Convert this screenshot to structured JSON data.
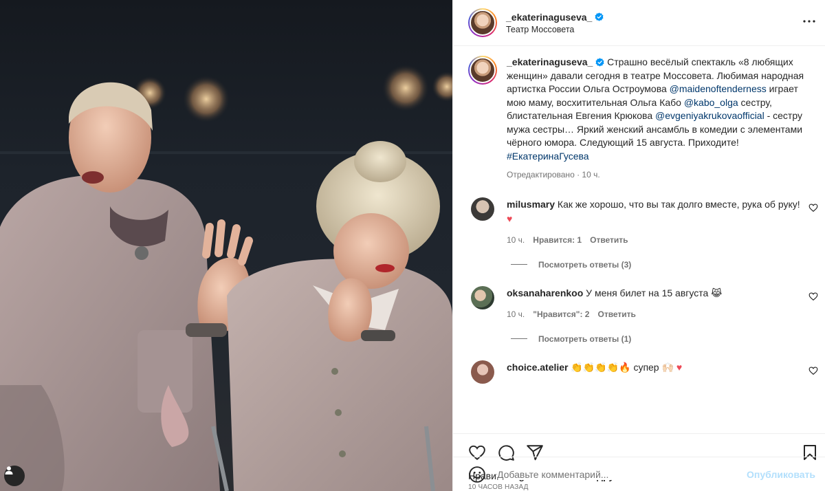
{
  "post": {
    "username": "_ekaterinaguseva_",
    "location": "Театр Моссовета",
    "caption_user": "_ekaterinaguseva_",
    "caption_text_1": " Страшно весёлый спектакль «8 любящих женщин» давали сегодня в театре Моссовета. Любимая народная артистка России Ольга Остроумова ",
    "mention_1": "@maidenoftenderness",
    "caption_text_2": " играет мою маму, восхитительная Ольга Кабо ",
    "mention_2": "@kabo_olga",
    "caption_text_3": " сестру, блистательная Евгения Крюкова ",
    "mention_3": "@evgeniyakrukovaofficial",
    "caption_text_4": " - сестру мужа сестры… Яркий женский ансамбль в комедии с элементами чёрного юмора. Следующий 15 августа. Приходите! ",
    "hashtag": "#ЕкатеринаГусева",
    "caption_meta": "Отредактировано · 10 ч."
  },
  "comments": [
    {
      "user": "milusmary",
      "text": " Как же хорошо, что вы так долго вместе, рука об руку! ",
      "emoji": "♥",
      "time": "10 ч.",
      "likes": "Нравится: 1",
      "reply": "Ответить",
      "replies": "Посмотреть ответы (3)"
    },
    {
      "user": "oksanaharenkoo",
      "text": " У меня билет на 15 августа ",
      "emoji": "😹",
      "time": "10 ч.",
      "likes": "\"Нравится\": 2",
      "reply": "Ответить",
      "replies": "Посмотреть ответы (1)"
    },
    {
      "user": "choice.atelier",
      "text": " 👏👏👏👏🔥 супер 🙌🏻",
      "emoji": "♥"
    }
  ],
  "likes": {
    "prefix": "Нравится ",
    "user": "agurianova5003",
    "middle": " и ",
    "suffix": "другим"
  },
  "date": "10 ЧАСОВ НАЗАД",
  "add_comment": {
    "placeholder": "Добавьте комментарий...",
    "publish": "Опубликовать"
  },
  "colors": {
    "accent": "#0095f6",
    "link": "#00376b",
    "heart": "#ed4956"
  },
  "icons": [
    "user-tag-icon",
    "verified-icon",
    "more-icon",
    "heart-icon",
    "comment-icon",
    "share-icon",
    "bookmark-icon",
    "emoji-icon"
  ]
}
